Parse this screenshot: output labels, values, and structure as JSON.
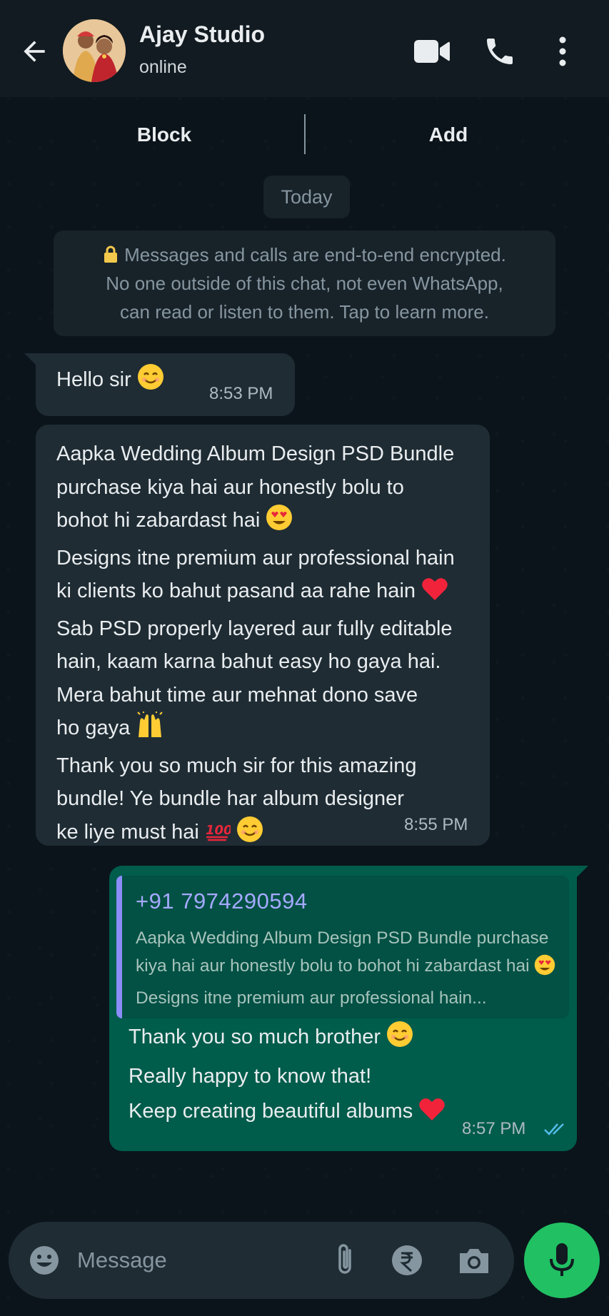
{
  "header": {
    "contact_name": "Ajay Studio",
    "status": "online"
  },
  "actions": {
    "block_label": "Block",
    "add_label": "Add"
  },
  "date_chip": "Today",
  "encryption_notice": {
    "line1": "Messages and calls are end-to-end encrypted.",
    "line2": "No one outside of this chat, not even WhatsApp,",
    "line3": "can read or listen to them. Tap to learn more."
  },
  "messages": [
    {
      "direction": "incoming",
      "text": "Hello sir",
      "time": "8:53 PM"
    },
    {
      "direction": "incoming",
      "lines": [
        "Aapka Wedding Album Design PSD Bundle",
        "purchase kiya hai aur honestly bolu to",
        "bohot hi zabardast hai",
        "Designs itne premium aur professional hain",
        "ki clients ko bahut pasand aa rahe hain",
        "Sab PSD properly layered aur fully editable",
        "hain, kaam karna bahut easy ho gaya hai.",
        "Mera bahut time aur mehnat dono save",
        "ho gaya",
        "Thank you so much sir for this amazing",
        "bundle! Ye bundle har album designer",
        "ke liye must hai"
      ],
      "time": "8:55 PM"
    },
    {
      "direction": "outgoing",
      "quote": {
        "sender": "+91 7974290594",
        "line1": "Aapka Wedding Album Design PSD Bundle purchase",
        "line2": "kiya hai aur honestly bolu to bohot hi zabardast hai",
        "line3": "Designs itne premium aur professional hain..."
      },
      "lines": [
        "Thank you so much brother",
        "Really happy to know that!",
        "Keep creating beautiful albums"
      ],
      "time": "8:57 PM",
      "read": true
    }
  ],
  "composer": {
    "placeholder": "Message"
  },
  "colors": {
    "background": "#0b141a",
    "header": "#111b21",
    "incoming_bubble": "#1f2c34",
    "outgoing_bubble": "#005c4b",
    "accent": "#21c063",
    "read_ticks": "#53bdeb"
  }
}
